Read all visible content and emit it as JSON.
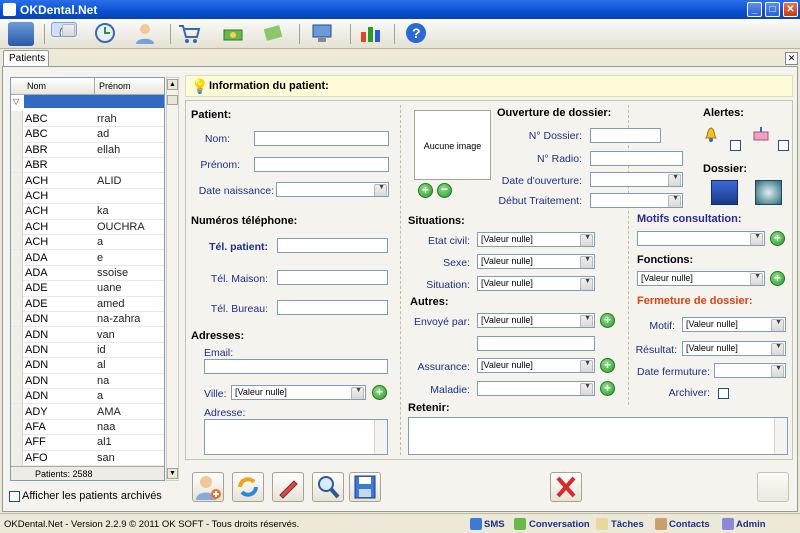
{
  "window": {
    "title": "OKDental.Net",
    "min": "_",
    "max": "□",
    "close": "✕"
  },
  "tabs": {
    "active": "Patients",
    "close": "✕"
  },
  "grid": {
    "col_nom": "Nom",
    "col_prenom": "Prénom",
    "footer": "Patients: 2588",
    "rows": [
      {
        "nom": "ABC",
        "prenom": "rrah"
      },
      {
        "nom": "ABC",
        "prenom": "ad"
      },
      {
        "nom": "ABR",
        "prenom": "ellah"
      },
      {
        "nom": "ABR",
        "prenom": ""
      },
      {
        "nom": "ACH",
        "prenom": "ALID"
      },
      {
        "nom": "ACH",
        "prenom": ""
      },
      {
        "nom": "ACH",
        "prenom": "ka"
      },
      {
        "nom": "ACH",
        "prenom": "OUCHRA"
      },
      {
        "nom": "ACH",
        "prenom": "a"
      },
      {
        "nom": "ADA",
        "prenom": "e"
      },
      {
        "nom": "ADA",
        "prenom": "ssoise"
      },
      {
        "nom": "ADE",
        "prenom": "uane"
      },
      {
        "nom": "ADE",
        "prenom": "amed"
      },
      {
        "nom": "ADN",
        "prenom": "na-zahra"
      },
      {
        "nom": "ADN",
        "prenom": "van"
      },
      {
        "nom": "ADN",
        "prenom": "id"
      },
      {
        "nom": "ADN",
        "prenom": "al"
      },
      {
        "nom": "ADN",
        "prenom": "na"
      },
      {
        "nom": "ADN",
        "prenom": "a"
      },
      {
        "nom": "ADY",
        "prenom": "AMA"
      },
      {
        "nom": "AFA",
        "prenom": "naa"
      },
      {
        "nom": "AFF",
        "prenom": "al1"
      },
      {
        "nom": "AFO",
        "prenom": "san"
      }
    ]
  },
  "archived_label": "Afficher les patients archivés",
  "info_title": "Information du patient:",
  "patient": {
    "section": "Patient:",
    "nom": "Nom:",
    "prenom": "Prénom:",
    "naissance": "Date naissance:"
  },
  "image": {
    "none": "Aucune image"
  },
  "ouverture": {
    "section": "Ouverture de dossier:",
    "dossier": "N° Dossier:",
    "radio": "N° Radio:",
    "date": "Date d'ouverture:",
    "debut": "Début Traitement:"
  },
  "alertes": {
    "section": "Alertes:",
    "dossier": "Dossier:"
  },
  "tel": {
    "section": "Numéros téléphone:",
    "patient": "Tél. patient:",
    "maison": "Tél. Maison:",
    "bureau": "Tél. Bureau:"
  },
  "situations": {
    "section": "Situations:",
    "etat": "Etat civil:",
    "sexe": "Sexe:",
    "situation": "Situation:",
    "null": "[Valeur nulle]"
  },
  "autres": {
    "section": "Autres:",
    "envoye": "Envoyé par:",
    "assurance": "Assurance:",
    "maladie": "Maladie:"
  },
  "adresses": {
    "section": "Adresses:",
    "email": "Email:",
    "ville": "Ville:",
    "adresse": "Adresse:"
  },
  "motifs": {
    "section": "Motifs consultation:",
    "color": "#2a2a9a"
  },
  "fonctions": {
    "section": "Fonctions:"
  },
  "fermeture": {
    "section": "Fermeture de dossier:",
    "color": "#e04010",
    "motif": "Motif:",
    "resultat": "Résultat:",
    "date": "Date fermuture:",
    "archiver": "Archiver:"
  },
  "retenir": "Retenir:",
  "status": {
    "copyright": "OKDental.Net - Version 2.2.9 © 2011 OK SOFT - Tous droits réservés.",
    "sms": "SMS",
    "conversation": "Conversation",
    "taches": "Tâches",
    "contacts": "Contacts",
    "admin": "Admin"
  }
}
